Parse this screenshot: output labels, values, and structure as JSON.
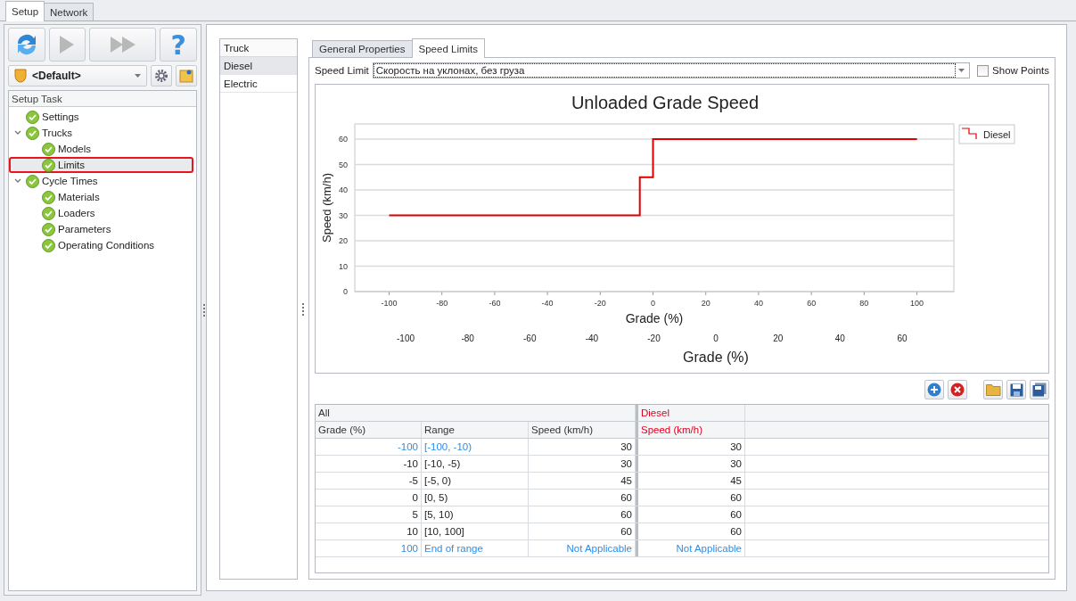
{
  "top_tabs": [
    {
      "label": "Setup",
      "selected": true
    },
    {
      "label": "Network",
      "selected": false
    }
  ],
  "toolbar": [
    {
      "kind": "refresh",
      "disabled": false
    },
    {
      "kind": "run",
      "disabled": true
    },
    {
      "kind": "run_all",
      "disabled": true
    },
    {
      "kind": "help",
      "disabled": false,
      "glyph": "?"
    }
  ],
  "profile": {
    "value": "<Default>"
  },
  "task_tree": {
    "header": "Setup Task",
    "items": [
      {
        "label": "Settings",
        "selected": false
      },
      {
        "label": "Trucks",
        "selected": false,
        "expanded": true,
        "children": [
          {
            "label": "Models",
            "selected": false
          },
          {
            "label": "Limits",
            "selected": true
          }
        ]
      },
      {
        "label": "Cycle Times",
        "selected": false,
        "expanded": true,
        "children": [
          {
            "label": "Materials",
            "selected": false
          },
          {
            "label": "Loaders",
            "selected": false
          },
          {
            "label": "Parameters",
            "selected": false
          },
          {
            "label": "Operating Conditions",
            "selected": false
          }
        ]
      }
    ]
  },
  "trucks": {
    "header": "Truck",
    "items": [
      {
        "label": "Diesel",
        "selected": true
      },
      {
        "label": "Electric",
        "selected": false
      }
    ]
  },
  "detail_tabs": [
    {
      "label": "General Properties",
      "selected": false
    },
    {
      "label": "Speed Limits",
      "selected": true
    }
  ],
  "speed_limit": {
    "label": "Speed Limit",
    "value": "Скорость на уклонах, без груза"
  },
  "show_points": {
    "label": "Show Points",
    "checked": false
  },
  "chart": {
    "chart_data": {
      "type": "line",
      "title": "Unloaded Grade Speed",
      "xlabel": "Grade (%)",
      "ylabel": "Speed (km/h)",
      "x": [
        -100,
        -5,
        -5,
        0,
        0,
        100
      ],
      "series": [
        {
          "name": "Diesel",
          "color": "#e00000",
          "values": [
            30,
            30,
            45,
            45,
            60,
            60
          ]
        }
      ],
      "grid": true,
      "xlim": [
        -113,
        114
      ],
      "ylim": [
        0,
        66
      ],
      "xticks": [
        -100,
        -80,
        -60,
        -40,
        -20,
        0,
        20,
        40,
        60,
        80,
        100
      ],
      "yticks": [
        0,
        10,
        20,
        30,
        40,
        50,
        60
      ]
    },
    "secondary_axis": {
      "title": "Grade (%)",
      "ticks": [
        "-100",
        "-80",
        "-60",
        "-40",
        "-20",
        "0",
        "20",
        "40",
        "60"
      ]
    }
  },
  "grid_toolbar": [
    {
      "kind": "add"
    },
    {
      "kind": "delete"
    },
    {
      "kind": "open"
    },
    {
      "kind": "save"
    },
    {
      "kind": "save_all"
    }
  ],
  "table": {
    "groups": [
      {
        "label": "All",
        "color": "#333333",
        "columns": [
          {
            "label": "Grade (%)"
          },
          {
            "label": "Range"
          },
          {
            "label": "Speed (km/h)"
          }
        ]
      },
      {
        "label": "Diesel",
        "color": "#e00020",
        "columns": [
          {
            "label": "Speed (km/h)"
          }
        ]
      }
    ],
    "rows": [
      {
        "kind": "start",
        "cells": [
          "-100",
          "[-100, -10)",
          "30",
          "30"
        ]
      },
      {
        "kind": "normal",
        "cells": [
          "-10",
          "[-10, -5)",
          "30",
          "30"
        ]
      },
      {
        "kind": "normal",
        "cells": [
          "-5",
          "[-5, 0)",
          "45",
          "45"
        ]
      },
      {
        "kind": "normal",
        "cells": [
          "0",
          "[0, 5)",
          "60",
          "60"
        ]
      },
      {
        "kind": "normal",
        "cells": [
          "5",
          "[5, 10)",
          "60",
          "60"
        ]
      },
      {
        "kind": "normal",
        "cells": [
          "10",
          "[10, 100]",
          "60",
          "60"
        ]
      },
      {
        "kind": "end",
        "cells": [
          "100",
          "End of range",
          "Not Applicable",
          "Not Applicable"
        ]
      }
    ]
  }
}
